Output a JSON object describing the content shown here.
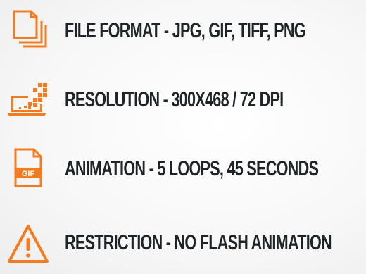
{
  "accent_color": "#f47c20",
  "text_color": "#1e2427",
  "specs": [
    {
      "icon": "files-icon",
      "text": "FILE FORMAT - JPG, GIF, TIFF, PNG"
    },
    {
      "icon": "laptop-resolution-icon",
      "text": "RESOLUTION - 300X468 / 72 DPI"
    },
    {
      "icon": "gif-file-icon",
      "text": "ANIMATION - 5 LOOPS, 45 SECONDS",
      "icon_text": "GIF"
    },
    {
      "icon": "warning-icon",
      "text": "RESTRICTION - NO FLASH ANIMATION"
    }
  ]
}
